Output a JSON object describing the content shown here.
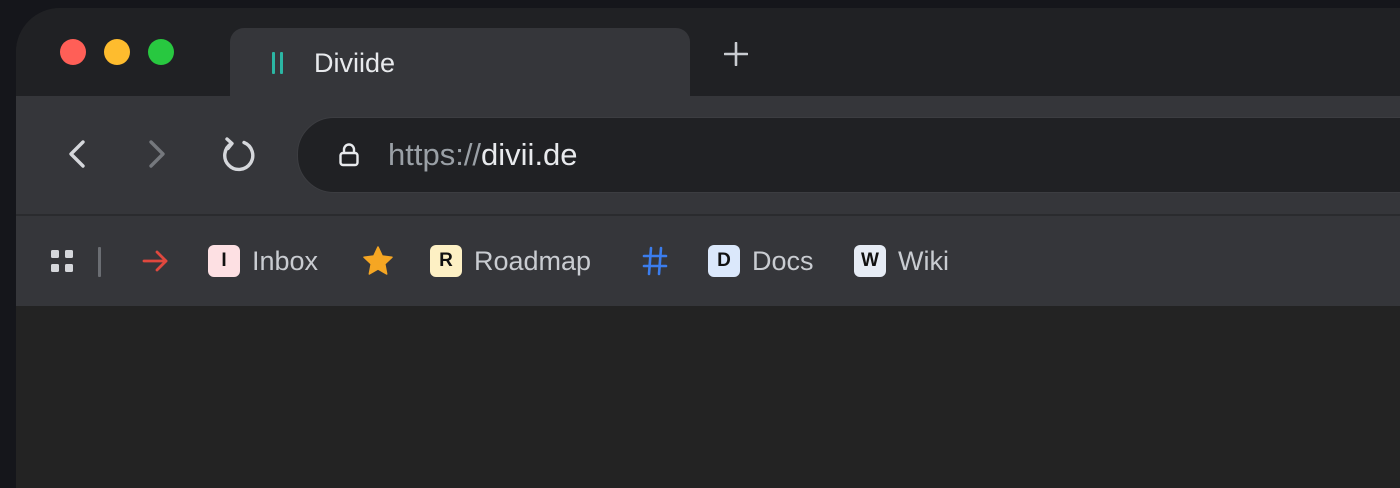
{
  "window": {
    "traffic_lights": {
      "close_color": "#ff5f57",
      "minimize_color": "#febc2e",
      "maximize_color": "#28c840"
    }
  },
  "tab": {
    "title": "Diviide",
    "icon": "pause-bars-icon",
    "icon_color": "#2bb6a3"
  },
  "new_tab": {
    "icon": "plus-icon"
  },
  "toolbar": {
    "back_icon": "chevron-left-icon",
    "forward_icon": "chevron-right-icon",
    "reload_icon": "reload-icon"
  },
  "omnibox": {
    "lock_icon": "lock-icon",
    "url_scheme": "https://",
    "url_host": "divii.de"
  },
  "bookmarks": {
    "apps_icon": "apps-grid-icon",
    "items": [
      {
        "icon": "arrow-right-icon",
        "color": "#e0483e"
      },
      {
        "badge": "I",
        "label": "Inbox",
        "badge_color": "#fde0e3"
      },
      {
        "icon": "star-icon",
        "color": "#f5a623"
      },
      {
        "badge": "R",
        "label": "Roadmap",
        "badge_color": "#fdf0c4"
      },
      {
        "icon": "hash-icon",
        "color": "#3b7ded"
      },
      {
        "badge": "D",
        "label": "Docs",
        "badge_color": "#dbe8fb"
      },
      {
        "badge": "W",
        "label": "Wiki",
        "badge_color": "#e6ecf5"
      }
    ]
  }
}
